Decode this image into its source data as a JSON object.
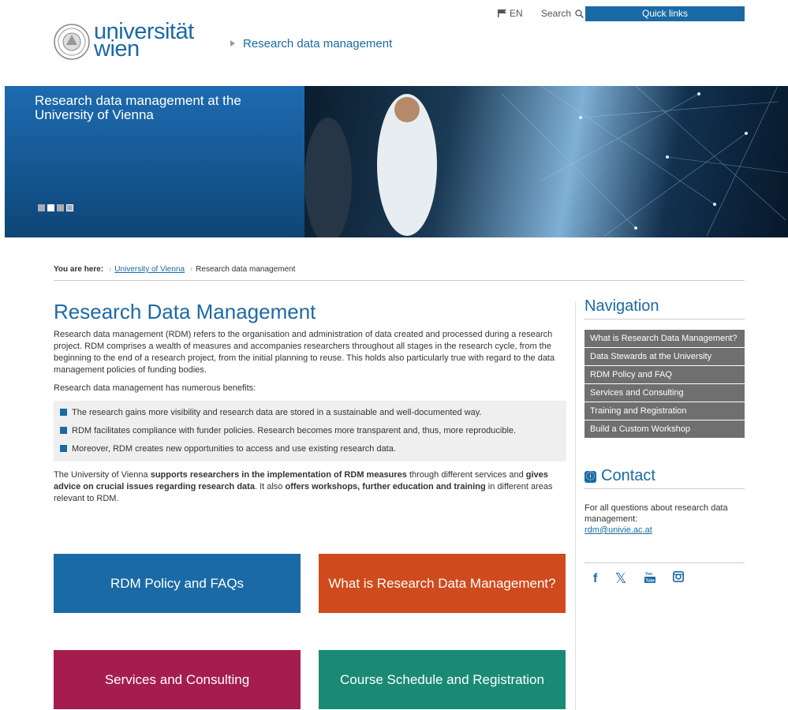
{
  "util": {
    "lang": "EN",
    "search": "Search",
    "quick_links": "Quick links"
  },
  "header": {
    "logo_line1": "universität",
    "logo_line2": "wien",
    "section": "Research data management"
  },
  "hero": {
    "title": "Research data management at the University of Vienna"
  },
  "breadcrumb": {
    "prefix": "You are here:",
    "items": [
      "University of Vienna",
      "Research data management"
    ]
  },
  "main": {
    "title": "Research Data Management",
    "intro": "Research data management (RDM) refers to the organisation and administration of data created and processed during a research project. RDM comprises a wealth of measures and accompanies researchers throughout all stages in the research cycle, from the beginning to the end of a research project, from the initial planning to reuse. This holds also particularly true with regard to the data management policies of funding bodies.",
    "benefits_intro": "Research data management has numerous benefits:",
    "benefits": [
      "The research gains more visibility and research data are stored in a sustainable and well-documented way.",
      "RDM facilitates compliance with funder policies. Research becomes more transparent and, thus, more reproducible.",
      "Moreover, RDM creates new opportunities to access and use existing research data."
    ],
    "support_1": "The University of Vienna ",
    "support_2": "supports researchers in the implementation of RDM measures",
    "support_3": " through different services and ",
    "support_4": "gives advice on crucial issues regarding research data",
    "support_5": ". It also ",
    "support_6": "offers workshops, further education and training",
    "support_7": " in different areas relevant to RDM."
  },
  "tiles": [
    "RDM Policy and FAQs",
    "What is Research Data Management?",
    "Services and Consulting",
    "Course Schedule and Registration"
  ],
  "sidebar": {
    "nav_title": "Navigation",
    "nav_items": [
      "What is Research Data Management?",
      "Data Stewards at the University",
      "RDM Policy and FAQ",
      "Services and Consulting",
      "Training and Registration",
      "Build a Custom Workshop"
    ],
    "contact_title": "Contact",
    "contact_text": "For all questions about research data management:",
    "contact_email": "rdm@univie.ac.at"
  },
  "social": [
    "f",
    "𝕏",
    "You Tube",
    "instagram"
  ],
  "colors": {
    "brand_blue": "#1a6aa5",
    "tile_orange": "#cf4a1d",
    "tile_red": "#a51d4f",
    "tile_green": "#1a8a74",
    "nav_gray": "#6f6f6f"
  }
}
